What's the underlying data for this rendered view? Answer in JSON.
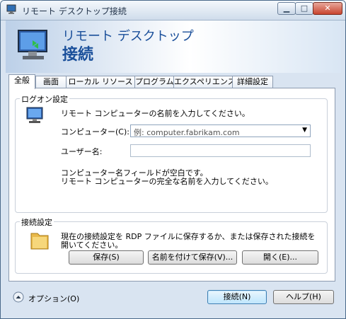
{
  "window": {
    "title": "リモート デスクトップ接続",
    "min_glyph": "▁",
    "max_glyph": "□",
    "close_glyph": "✕"
  },
  "banner": {
    "line1": "リモート デスクトップ",
    "line2": "接続"
  },
  "tabs": [
    "全般",
    "画面",
    "ローカル リソース",
    "プログラム",
    "エクスペリエンス",
    "詳細設定"
  ],
  "logon": {
    "title": "ログオン設定",
    "instruction": "リモート コンピューターの名前を入力してください。",
    "computer_label": "コンピューター(C):",
    "computer_placeholder": "例: computer.fabrikam.com",
    "user_label": "ユーザー名:",
    "user_value": "",
    "empty_msg1": "コンピューター名フィールドが空白です。",
    "empty_msg2": "リモート コンピューターの完全な名前を入力してください。"
  },
  "connection": {
    "title": "接続設定",
    "desc1": "現在の接続設定を RDP ファイルに保存するか、または保存された接続を",
    "desc2": "開いてください。",
    "save": "保存(S)",
    "save_as": "名前を付けて保存(V)...",
    "open": "開く(E)..."
  },
  "footer": {
    "options": "オプション(O)",
    "connect": "接続(N)",
    "help": "ヘルプ(H)"
  }
}
